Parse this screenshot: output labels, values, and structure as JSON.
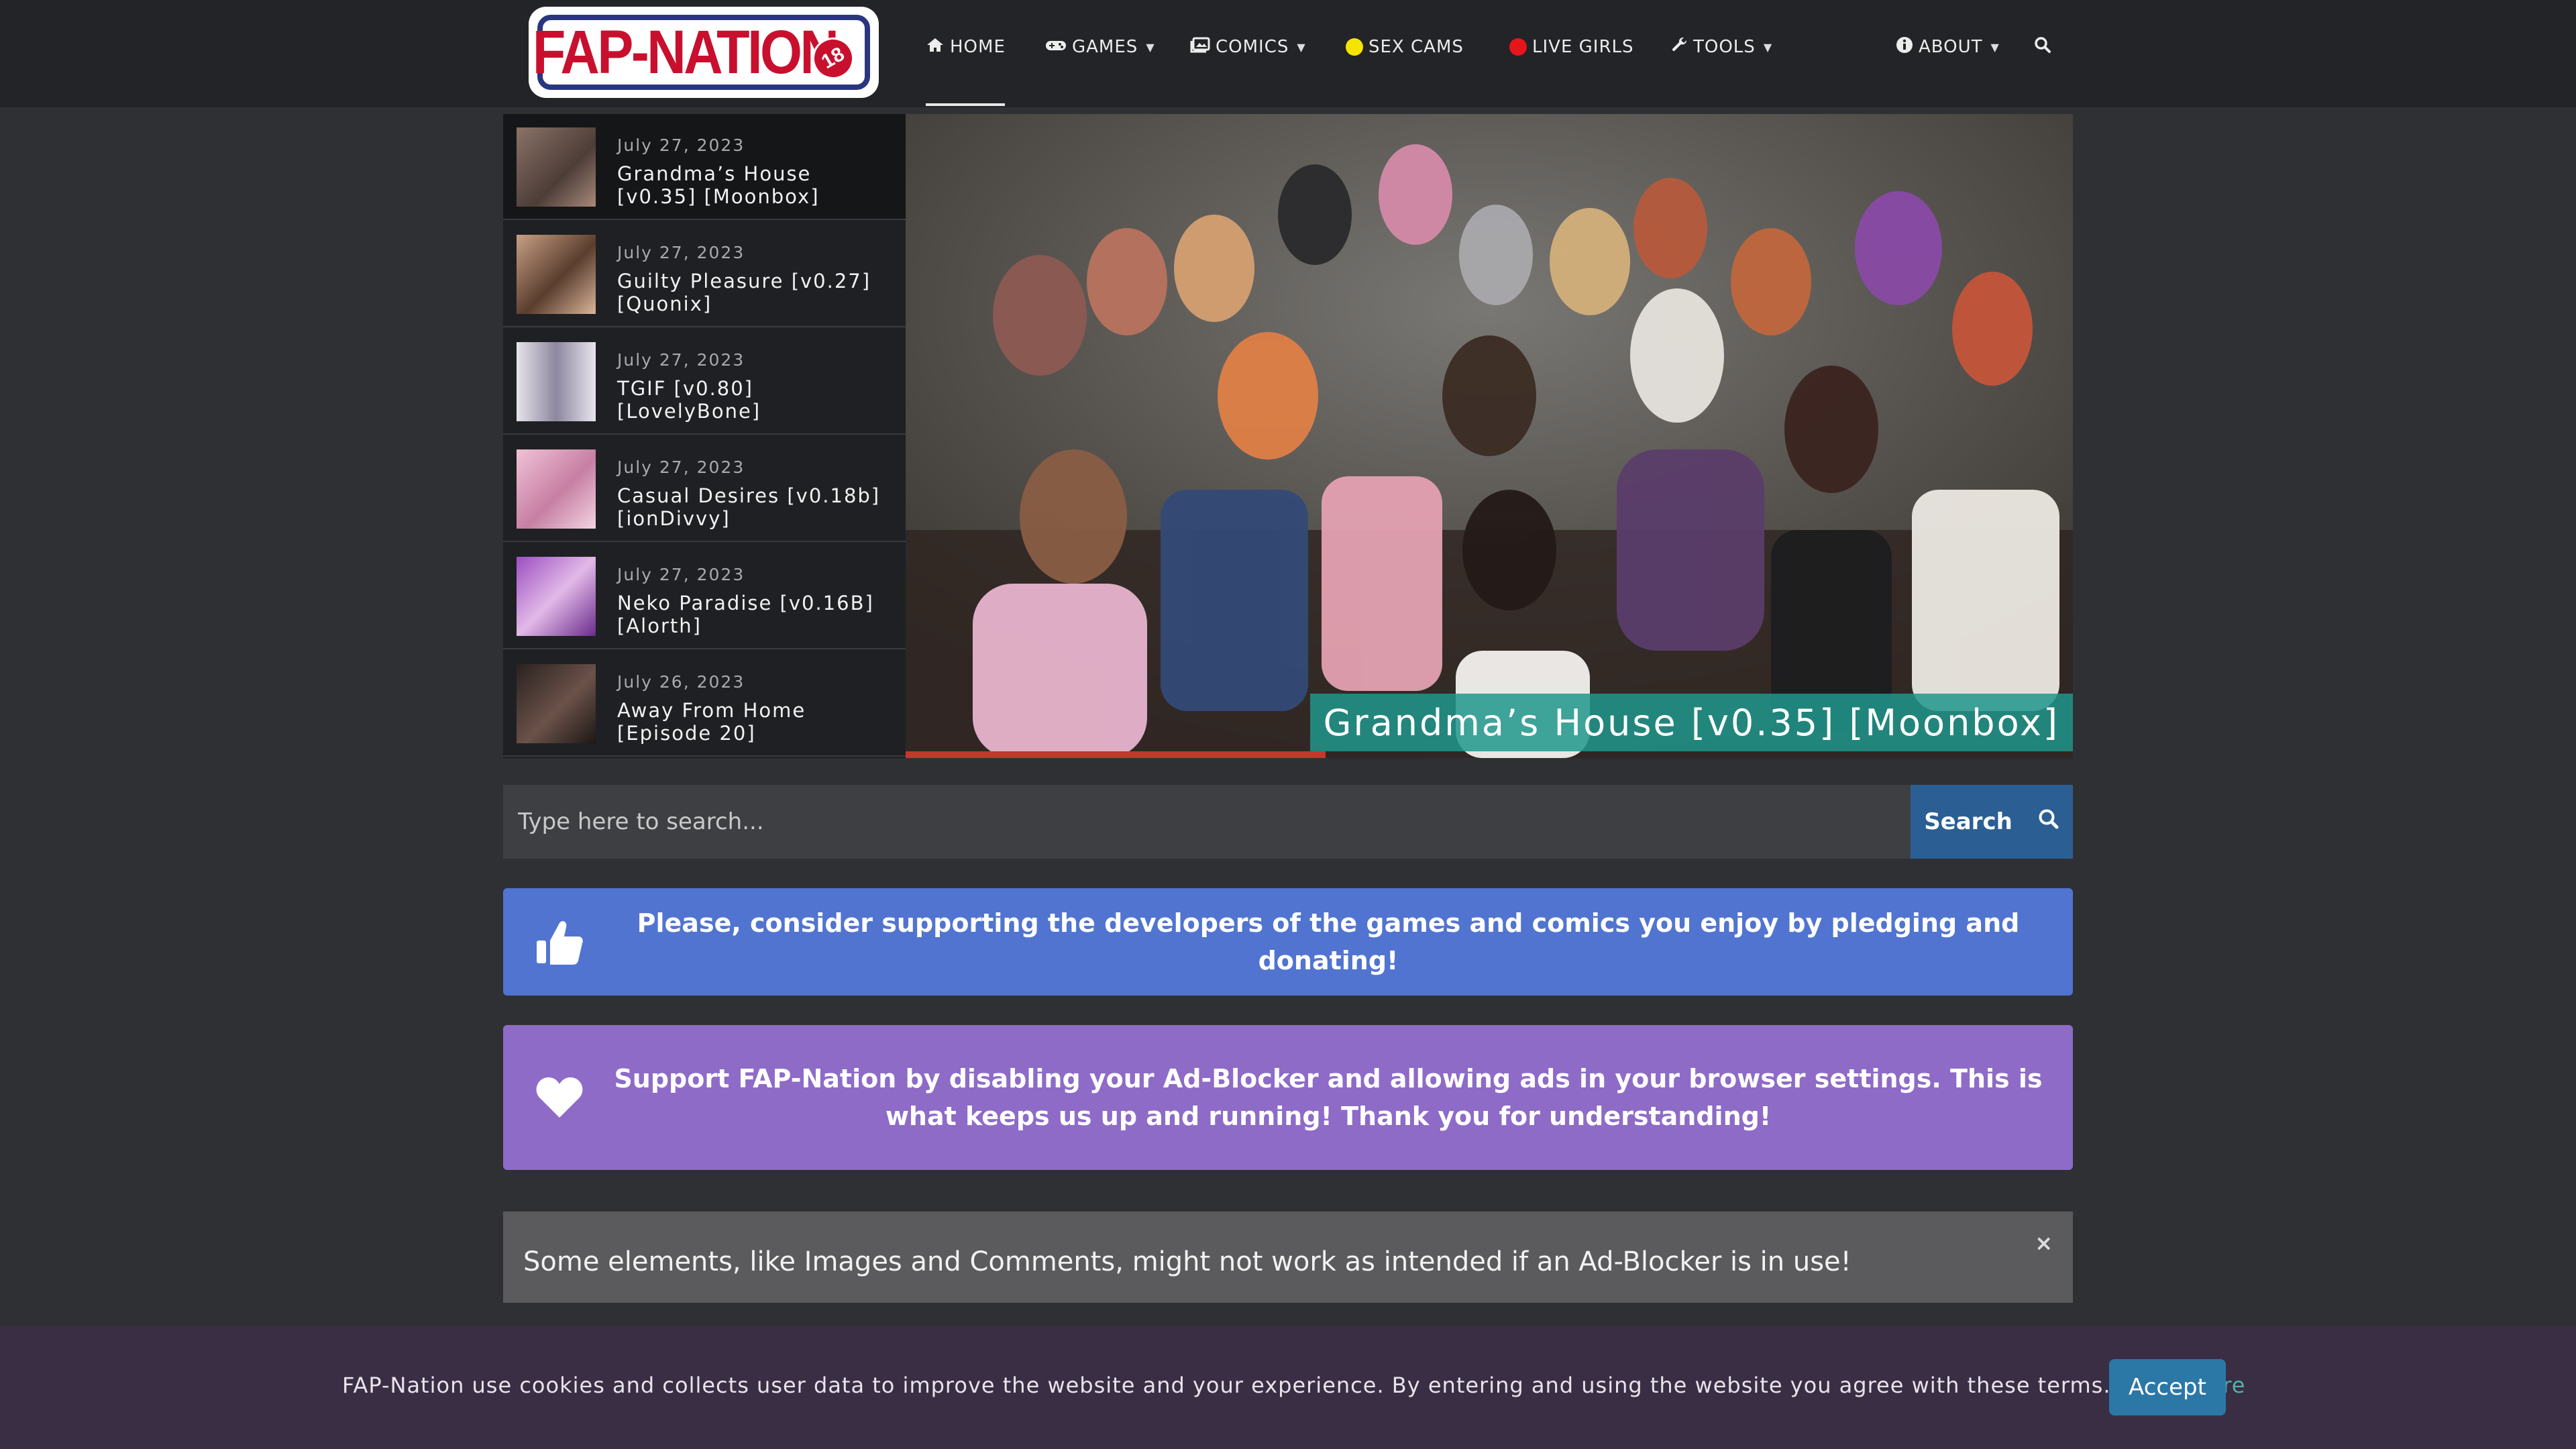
{
  "brand": {
    "logo_text": "FAP-NATION",
    "logo_badge": "18"
  },
  "nav": {
    "items": [
      {
        "label": "HOME",
        "icon": "home-icon",
        "dropdown": false,
        "active": true
      },
      {
        "label": "GAMES",
        "icon": "gamepad-icon",
        "dropdown": true
      },
      {
        "label": "COMICS",
        "icon": "comics-icon",
        "dropdown": true
      },
      {
        "label": "SEX CAMS",
        "icon": "yellow-dot-icon",
        "dropdown": false
      },
      {
        "label": "LIVE GIRLS",
        "icon": "red-dot-icon",
        "dropdown": false
      },
      {
        "label": "TOOLS",
        "icon": "wrench-icon",
        "dropdown": true
      },
      {
        "label": "ABOUT",
        "icon": "info-icon",
        "dropdown": true
      }
    ],
    "search_icon": "search-icon"
  },
  "latest": [
    {
      "date": "July 27, 2023",
      "title": "Grandma’s House [v0.35] [Moonbox]",
      "thumb_color": "#6b5a52"
    },
    {
      "date": "July 27, 2023",
      "title": "Guilty Pleasure [v0.27] [Quonix]",
      "thumb_color": "#8a6a55"
    },
    {
      "date": "July 27, 2023",
      "title": "TGIF [v0.80] [LovelyBone]",
      "thumb_color": "#b7b3c2"
    },
    {
      "date": "July 27, 2023",
      "title": "Casual Desires [v0.18b] [ionDivvy]",
      "thumb_color": "#d89ab8"
    },
    {
      "date": "July 27, 2023",
      "title": "Neko Paradise [v0.16B] [Alorth]",
      "thumb_color": "#7b3f93"
    },
    {
      "date": "July 26, 2023",
      "title": "Away From Home [Episode 20]",
      "thumb_color": "#4a3b36"
    }
  ],
  "hero": {
    "caption": "Grandma’s House [v0.35] [Moonbox]",
    "progress": 0.36
  },
  "search": {
    "placeholder": "Type here to search...",
    "button_label": "Search"
  },
  "notices": {
    "support_devs": "Please, consider supporting the developers of the games and comics you enjoy by pledging and donating!",
    "disable_adblock": "Support FAP-Nation by disabling your Ad-Blocker and allowing ads in your browser settings. This is what keeps us up and running! Thank you for understanding!",
    "adblock_warning": "Some elements, like Images and Comments, might not work as intended if an Ad-Blocker is in use!",
    "close_label": "×"
  },
  "cookie": {
    "text": "FAP-Nation use cookies and collects user data to improve the website and your experience. By entering and using the website you agree with these terms.",
    "link": "Learn More",
    "accept": "Accept"
  },
  "colors": {
    "header_bg": "#232427",
    "page_bg": "#2f3034",
    "notice_blue": "#5174d0",
    "notice_purple": "#8e6bc7",
    "search_button": "#2b5f93",
    "cookie_bg": "#3a2e45",
    "accept_button": "#2b78a7",
    "link": "#4fb3a7"
  }
}
